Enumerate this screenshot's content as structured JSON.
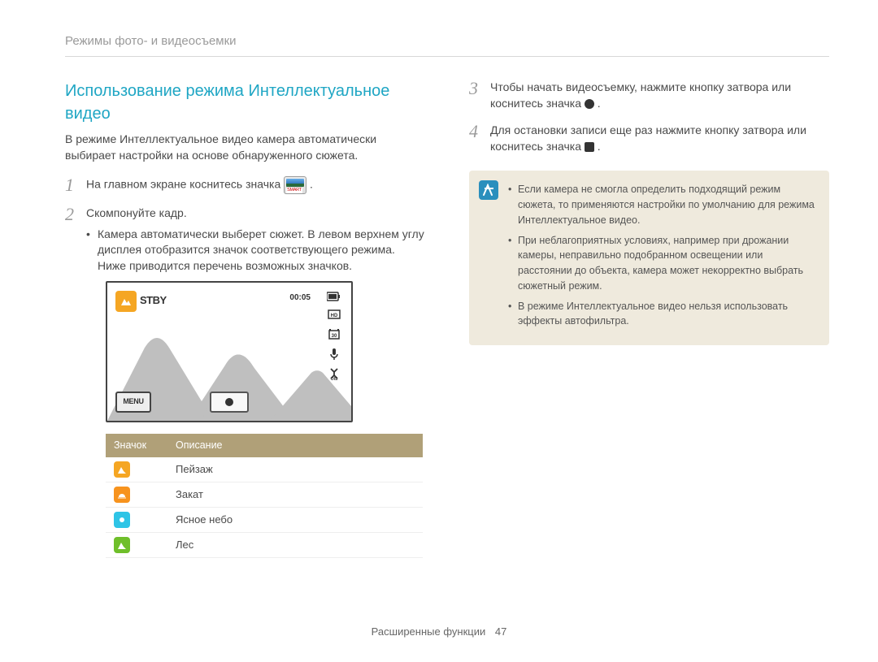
{
  "header": "Режимы фото- и видеосъемки",
  "title": "Использование режима Интеллектуальное видео",
  "intro": "В режиме Интеллектуальное видео камера автоматически выбирает настройки на основе обнаруженного сюжета.",
  "steps": {
    "s1_a": "На главном экране коснитесь значка ",
    "s1_b": ".",
    "s2": "Скомпонуйте кадр.",
    "s2_sub": "Камера автоматически выберет сюжет. В левом верхнем углу дисплея отобразится значок соответствующего режима. Ниже приводится перечень возможных значков.",
    "s3_a": "Чтобы начать видеосъемку, нажмите кнопку затвора или коснитесь значка ",
    "s3_b": ".",
    "s4_a": "Для остановки записи еще раз нажмите кнопку затвора или коснитесь значка ",
    "s4_b": "."
  },
  "preview": {
    "stby": "STBY",
    "time": "00:05",
    "menu": "MENU"
  },
  "table": {
    "h_icon": "Значок",
    "h_desc": "Описание",
    "rows": [
      {
        "cls": "orange",
        "label": "Пейзаж"
      },
      {
        "cls": "orange2",
        "label": "Закат"
      },
      {
        "cls": "cyan",
        "label": "Ясное небо"
      },
      {
        "cls": "green",
        "label": "Лес"
      }
    ]
  },
  "notes": [
    "Если камера не смогла определить подходящий режим сюжета, то применяются настройки по умолчанию для режима Интеллектуальное видео.",
    "При неблагоприятных условиях, например при дрожании камеры, неправильно подобранном освещении или расстоянии до объекта, камера может некорректно выбрать сюжетный режим.",
    "В режиме Интеллектуальное видео нельзя использовать эффекты автофильтра."
  ],
  "footer": {
    "section": "Расширенные функции",
    "page": "47"
  }
}
